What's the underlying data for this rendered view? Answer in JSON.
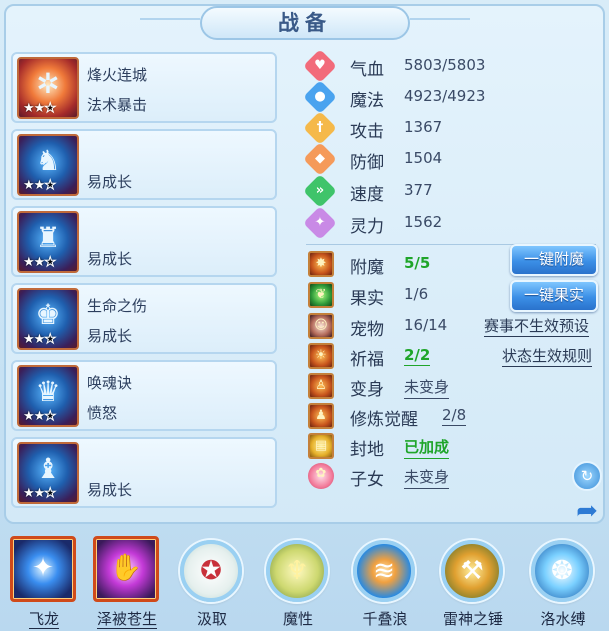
{
  "title": "战备",
  "equipment": [
    {
      "line1": "烽火连城",
      "line2": "法术暴击",
      "stars_filled": 2,
      "stars_total": 3,
      "icon": "fire-sword-icon"
    },
    {
      "line1": "",
      "line2": "易成长",
      "stars_filled": 2,
      "stars_total": 3,
      "icon": "blue-helmet-icon"
    },
    {
      "line1": "",
      "line2": "易成长",
      "stars_filled": 2,
      "stars_total": 3,
      "icon": "blue-helmet-icon"
    },
    {
      "line1": "生命之伤",
      "line2": "易成长",
      "stars_filled": 2,
      "stars_total": 3,
      "icon": "blue-armor-icon"
    },
    {
      "line1": "唤魂诀",
      "line2": "愤怒",
      "stars_filled": 2,
      "stars_total": 3,
      "icon": "blue-armor-icon"
    },
    {
      "line1": "",
      "line2": "易成长",
      "stars_filled": 2,
      "stars_total": 3,
      "icon": "blue-armor-icon"
    }
  ],
  "stats": [
    {
      "label": "气血",
      "value": "5803/5803",
      "icon": "heart-icon",
      "color": "#f26b7a"
    },
    {
      "label": "魔法",
      "value": "4923/4923",
      "icon": "mana-icon",
      "color": "#4aa3ef"
    },
    {
      "label": "攻击",
      "value": "1367",
      "icon": "sword-icon",
      "color": "#f5b94a"
    },
    {
      "label": "防御",
      "value": "1504",
      "icon": "shield-icon",
      "color": "#f59a5a"
    },
    {
      "label": "速度",
      "value": "377",
      "icon": "speed-icon",
      "color": "#3fc46a"
    },
    {
      "label": "灵力",
      "value": "1562",
      "icon": "spirit-icon",
      "color": "#c98ae6"
    }
  ],
  "effects": {
    "enchant": {
      "label": "附魔",
      "value": "5/5"
    },
    "fruit": {
      "label": "果实",
      "value": "1/6"
    },
    "pet": {
      "label": "宠物",
      "value": "16/14"
    },
    "bless": {
      "label": "祈福",
      "value": "2/2"
    },
    "transform": {
      "label": "变身",
      "value": "未变身"
    },
    "awaken": {
      "label": "修炼觉醒",
      "value": "2/8"
    },
    "land": {
      "label": "封地",
      "value": "已加成"
    },
    "child": {
      "label": "子女",
      "value": "未变身"
    }
  },
  "buttons": {
    "enchant": "一键附魔",
    "fruit": "一键果实"
  },
  "links": {
    "preset": "赛事不生效预设",
    "rules": "状态生效规则"
  },
  "skills": [
    {
      "name": "飞龙",
      "style": "square",
      "color": "#2a6fd8",
      "icon": "dragon-orb-icon"
    },
    {
      "name": "泽被苍生",
      "style": "square",
      "color": "#b33ac8",
      "icon": "palm-icon"
    },
    {
      "name": "汲取",
      "style": "circle",
      "color": "#e8f2f0",
      "icon": "absorb-icon"
    },
    {
      "name": "魔性",
      "style": "circle",
      "color": "#d8e08a",
      "icon": "demon-icon"
    },
    {
      "name": "千叠浪",
      "style": "circle",
      "color": "#3a9ae0",
      "icon": "wave-icon"
    },
    {
      "name": "雷神之锤",
      "style": "circle",
      "color": "#e0a03a",
      "icon": "hammer-icon"
    },
    {
      "name": "洛水缚",
      "style": "circle",
      "color": "#4ab0e8",
      "icon": "water-bind-icon"
    }
  ]
}
